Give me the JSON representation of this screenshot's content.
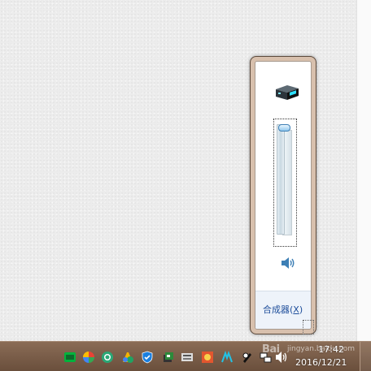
{
  "volume_flyout": {
    "device_icon": "speaker-device-icon",
    "volume_level": 1.0,
    "mute_icon": "speaker-volume-icon",
    "mixer_label": "合成器(",
    "mixer_hotkey": "X",
    "mixer_label_end": ")"
  },
  "taskbar": {
    "tray_icons": [
      "iqiyi-icon",
      "pinwheel-browser-icon",
      "360-browser-icon",
      "360-safe-icon",
      "shield-security-icon",
      "network-manager-icon",
      "tools-icon",
      "game-icon",
      "aurora-icon",
      "pen-icon",
      "network-icon",
      "power-icon",
      "speaker-icon"
    ],
    "clock_time": "17:42",
    "clock_date": "2016/12/21"
  },
  "watermark": {
    "text": "Bai",
    "url": "jingyan.baidu.com"
  },
  "colors": {
    "taskbar": "#6f5441",
    "flyout_border": "#d8c0ad",
    "link": "#1e4e9b",
    "thumb": "#92c8ee"
  }
}
